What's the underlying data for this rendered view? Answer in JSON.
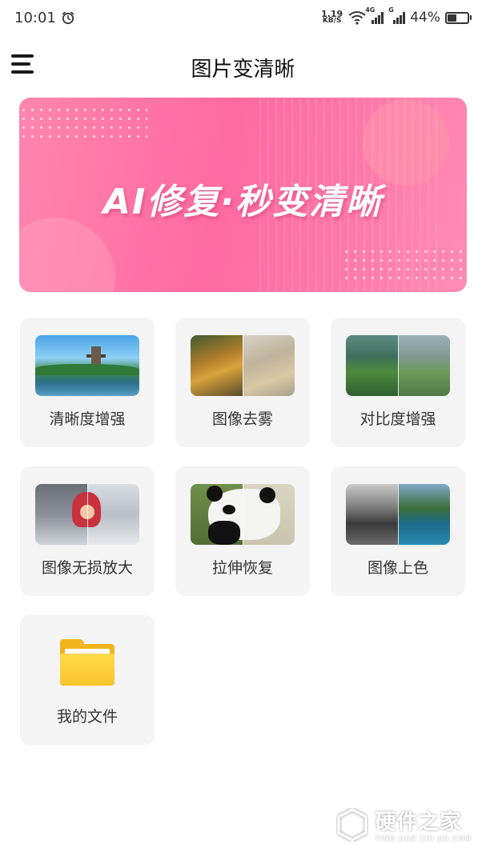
{
  "status_bar": {
    "time": "10:01",
    "net_speed_value": "1.19",
    "net_speed_unit": "KB/S",
    "signal1_tag": "4G",
    "signal2_tag": "G",
    "battery_percent_text": "44%",
    "battery_level": 0.44
  },
  "app_bar": {
    "title": "图片变清晰"
  },
  "banner": {
    "text": "AI修复·秒变清晰"
  },
  "features": [
    {
      "label": "清晰度增强"
    },
    {
      "label": "图像去雾"
    },
    {
      "label": "对比度增强"
    },
    {
      "label": "图像无损放大"
    },
    {
      "label": "拉伸恢复"
    },
    {
      "label": "图像上色"
    },
    {
      "label": "我的文件"
    }
  ],
  "watermark": {
    "cn": "硬件之家",
    "en": "YING JIAN ZHI JIA.COM"
  },
  "icons": {
    "menu": "menu-icon",
    "alarm": "alarm-icon",
    "wifi": "wifi-icon",
    "folder": "folder-icon"
  },
  "colors": {
    "banner_start": "#ff86ae",
    "banner_end": "#ff8cb4",
    "tile_bg": "#f4f4f4",
    "folder": "#f7c52a"
  }
}
